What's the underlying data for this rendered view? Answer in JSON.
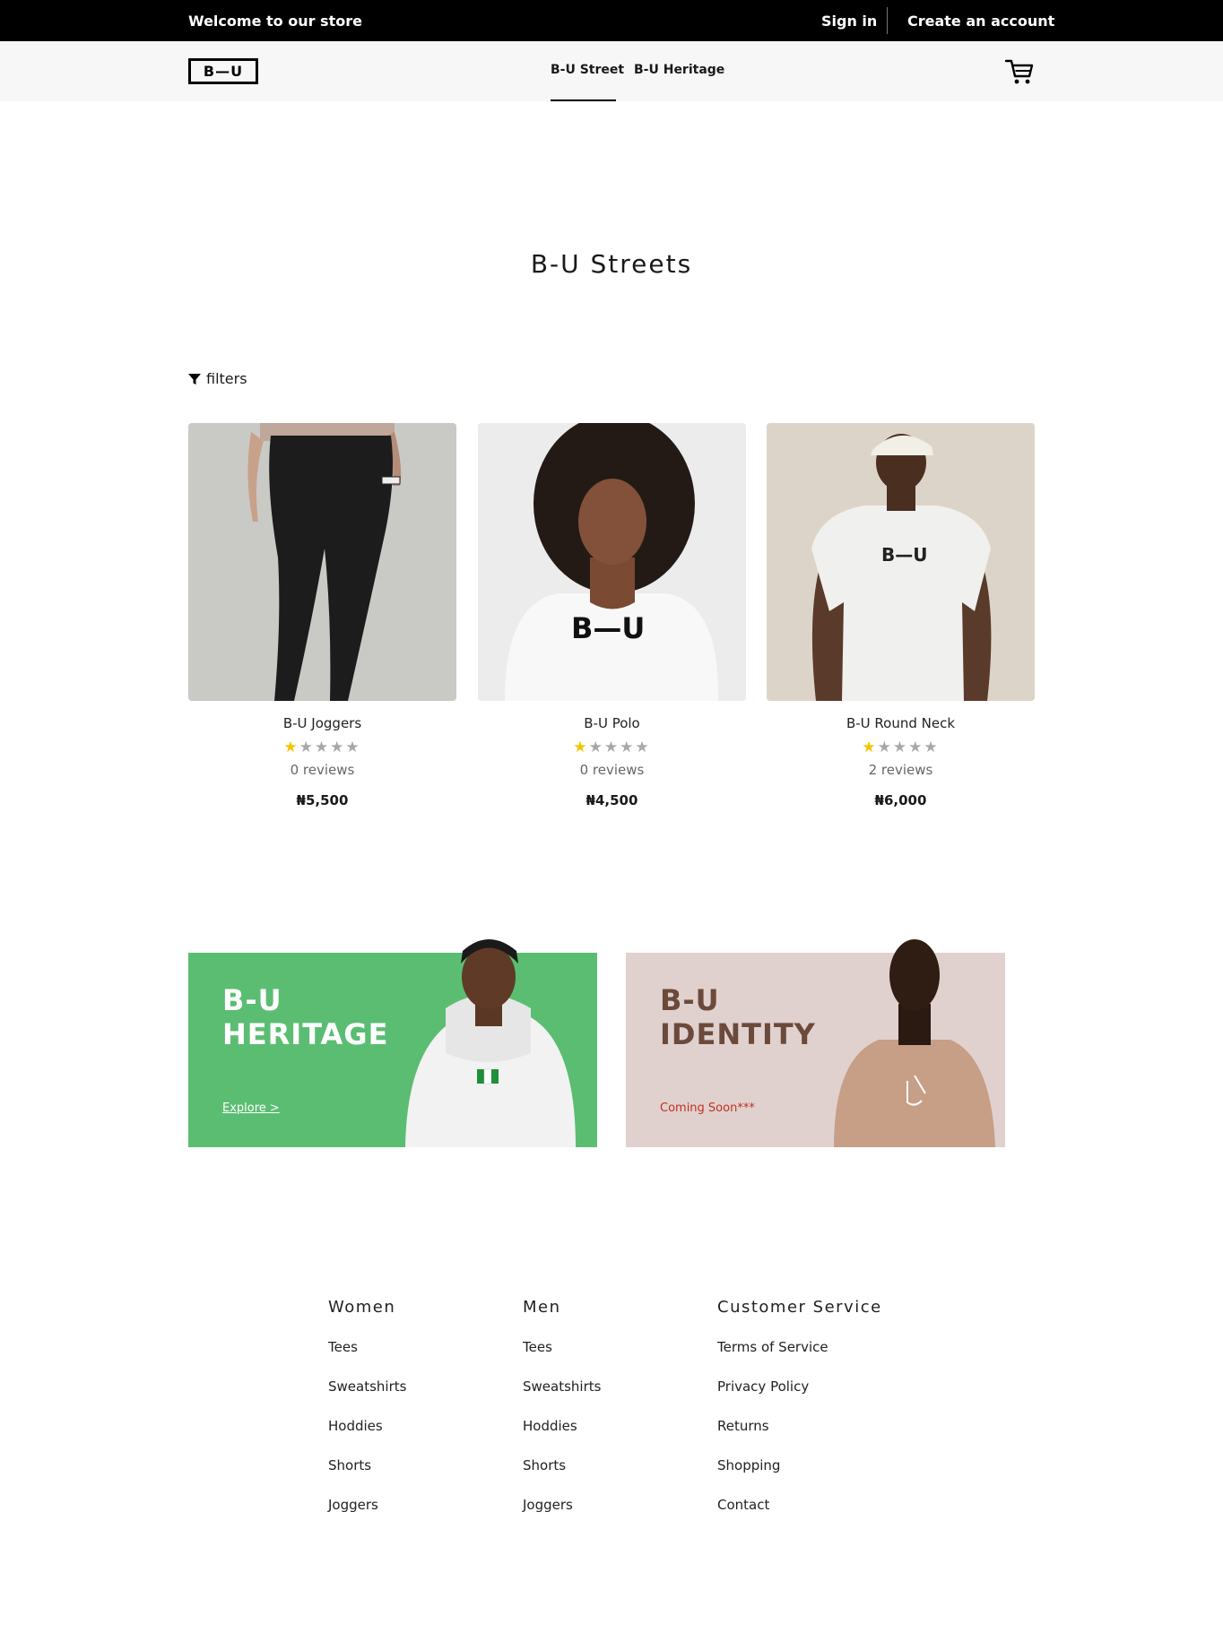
{
  "topbar": {
    "welcome": "Welcome to our store",
    "sign_in": "Sign in",
    "create_account": "Create an account"
  },
  "nav": {
    "logo": "B—U",
    "links": [
      "B-U Street",
      "B-U Heritage"
    ],
    "active": "B-U Street",
    "cart_icon": "cart-icon"
  },
  "page": {
    "title": "B-U Streets",
    "filters_label": "filters",
    "filters_icon": "funnel-icon"
  },
  "products": [
    {
      "name": "B-U Joggers",
      "rating": 1,
      "max_rating": 5,
      "reviews": "0 reviews",
      "price": "₦5,500"
    },
    {
      "name": "B-U Polo",
      "rating": 1,
      "max_rating": 5,
      "reviews": "0 reviews",
      "price": "₦4,500"
    },
    {
      "name": "B-U Round Neck",
      "rating": 1,
      "max_rating": 5,
      "reviews": "2 reviews",
      "price": "₦6,000"
    }
  ],
  "banners": {
    "heritage": {
      "title_line1": "B-U",
      "title_line2": "HERITAGE",
      "link": "Explore >",
      "color": "#5bbd72"
    },
    "identity": {
      "title_line1": "B-U",
      "title_line2": "IDENTITY",
      "link": "Coming Soon***",
      "color": "#e0d1cf"
    }
  },
  "footer": {
    "women": {
      "heading": "Women",
      "items": [
        "Tees",
        "Sweatshirts",
        "Hoddies",
        "Shorts",
        "Joggers"
      ]
    },
    "men": {
      "heading": "Men",
      "items": [
        "Tees",
        "Sweatshirts",
        "Hoddies",
        "Shorts",
        "Joggers"
      ]
    },
    "service": {
      "heading": "Customer Service",
      "items": [
        "Terms of Service",
        "Privacy Policy",
        "Returns",
        "Shopping",
        "Contact"
      ]
    }
  }
}
